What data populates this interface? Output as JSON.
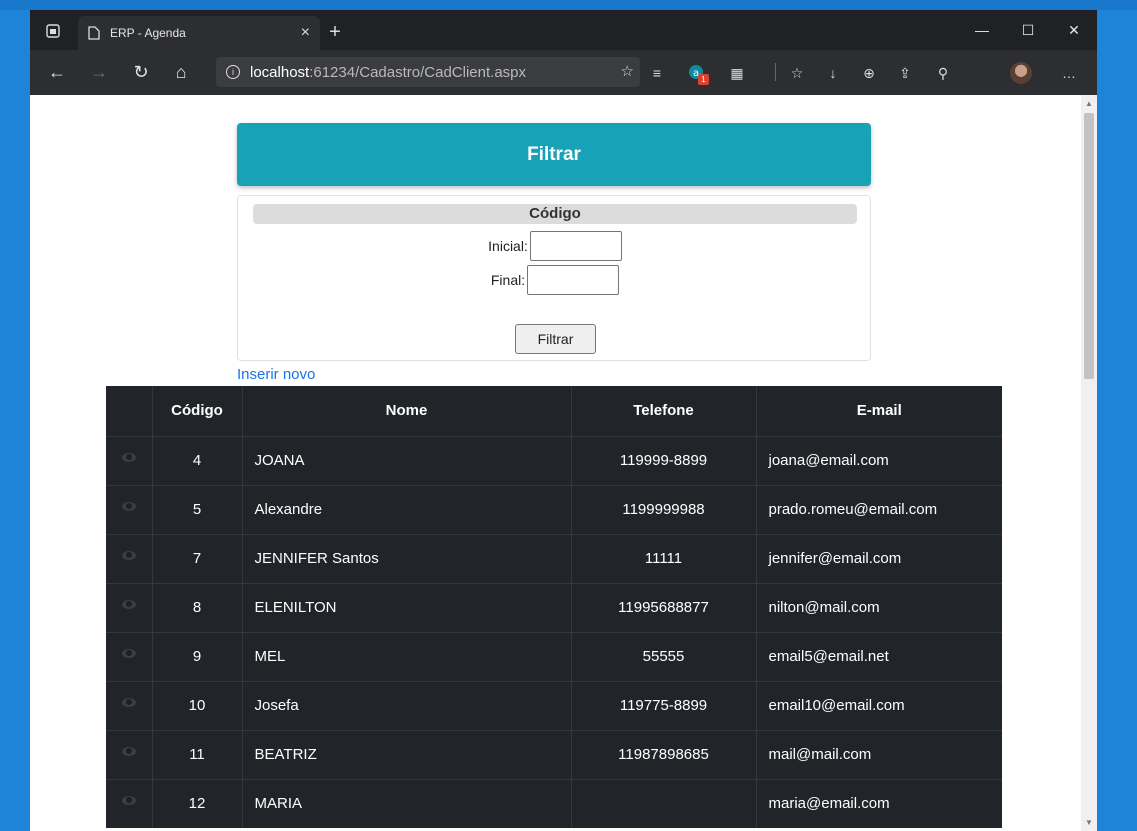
{
  "browser": {
    "tab_title": "ERP - Agenda",
    "url_host": "localhost",
    "url_path": ":61234/Cadastro/CadClient.aspx",
    "extension_badge": "1"
  },
  "filter": {
    "header": "Filtrar",
    "legend": "Código",
    "initial_label": "Inicial:",
    "initial_value": "",
    "final_label": "Final:",
    "final_value": "",
    "button_label": "Filtrar"
  },
  "insert_link": "Inserir novo",
  "table": {
    "headers": [
      "",
      "Código",
      "Nome",
      "Telefone",
      "E-mail"
    ],
    "rows": [
      {
        "codigo": "4",
        "nome": "JOANA",
        "telefone": "119999-8899",
        "email": "joana@email.com"
      },
      {
        "codigo": "5",
        "nome": "Alexandre",
        "telefone": "1199999988",
        "email": "prado.romeu@email.com"
      },
      {
        "codigo": "7",
        "nome": "JENNIFER Santos",
        "telefone": "11111",
        "email": "jennifer@email.com"
      },
      {
        "codigo": "8",
        "nome": "ELENILTON",
        "telefone": "11995688877",
        "email": "nilton@mail.com"
      },
      {
        "codigo": "9",
        "nome": "MEL",
        "telefone": "55555",
        "email": "email5@email.net"
      },
      {
        "codigo": "10",
        "nome": "Josefa",
        "telefone": "119775-8899",
        "email": "email10@email.com"
      },
      {
        "codigo": "11",
        "nome": "BEATRIZ",
        "telefone": "11987898685",
        "email": "mail@mail.com"
      },
      {
        "codigo": "12",
        "nome": "MARIA",
        "telefone": "",
        "email": "maria@email.com"
      }
    ]
  },
  "colors": {
    "filter_header": "#17a2b8",
    "table_dark": "#212529",
    "link": "#1a73e8"
  },
  "icons": {
    "row_action": "eye-icon"
  }
}
